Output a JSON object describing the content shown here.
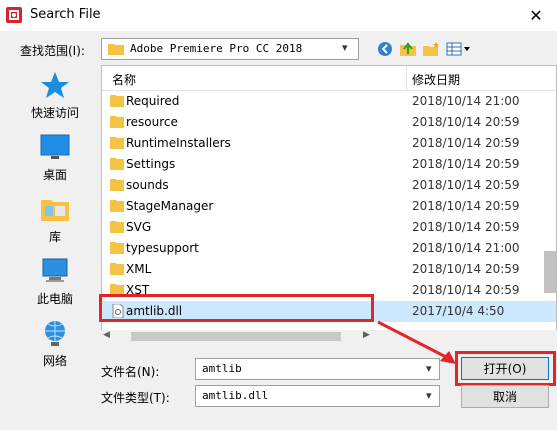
{
  "window": {
    "title": "Search File",
    "close_glyph": "✕"
  },
  "location": {
    "label": "查找范围(I):",
    "current": "Adobe Premiere Pro CC 2018"
  },
  "places": [
    {
      "label": "快速访问",
      "icon": "quick-access-star-icon"
    },
    {
      "label": "桌面",
      "icon": "desktop-icon"
    },
    {
      "label": "库",
      "icon": "library-icon"
    },
    {
      "label": "此电脑",
      "icon": "this-pc-icon"
    },
    {
      "label": "网络",
      "icon": "network-icon"
    }
  ],
  "columns": {
    "name": "名称",
    "date": "修改日期"
  },
  "files": [
    {
      "name": "Required",
      "date": "2018/10/14 21:00",
      "type": "folder"
    },
    {
      "name": "resource",
      "date": "2018/10/14 20:59",
      "type": "folder"
    },
    {
      "name": "RuntimeInstallers",
      "date": "2018/10/14 20:59",
      "type": "folder"
    },
    {
      "name": "Settings",
      "date": "2018/10/14 20:59",
      "type": "folder"
    },
    {
      "name": "sounds",
      "date": "2018/10/14 20:59",
      "type": "folder"
    },
    {
      "name": "StageManager",
      "date": "2018/10/14 20:59",
      "type": "folder"
    },
    {
      "name": "SVG",
      "date": "2018/10/14 20:59",
      "type": "folder"
    },
    {
      "name": "typesupport",
      "date": "2018/10/14 21:00",
      "type": "folder"
    },
    {
      "name": "XML",
      "date": "2018/10/14 20:59",
      "type": "folder"
    },
    {
      "name": "XST",
      "date": "2018/10/14 20:59",
      "type": "folder"
    },
    {
      "name": "amtlib.dll",
      "date": "2017/10/4 4:50",
      "type": "dll",
      "selected": true
    }
  ],
  "filename": {
    "label": "文件名(N):",
    "value": "amtlib"
  },
  "filetype": {
    "label": "文件类型(T):",
    "value": "amtlib.dll"
  },
  "buttons": {
    "open": "打开(O)",
    "cancel": "取消"
  },
  "colors": {
    "highlight_red": "#e0262a",
    "selection": "#cce8ff",
    "folder": "#f5c343"
  }
}
